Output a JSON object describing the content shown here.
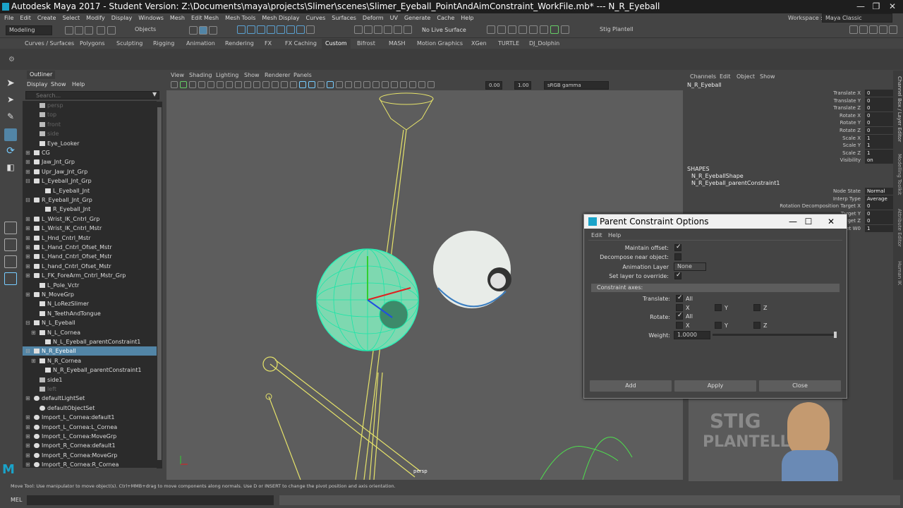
{
  "title": "Autodesk Maya 2017 - Student Version: Z:\\Documents\\maya\\projects\\Slimer\\scenes\\Slimer_Eyeball_PointAndAimConstraint_WorkFile.mb*   ---   N_R_Eyeball",
  "menu": [
    "File",
    "Edit",
    "Create",
    "Select",
    "Modify",
    "Display",
    "Windows",
    "Mesh",
    "Edit Mesh",
    "Mesh Tools",
    "Mesh Display",
    "Curves",
    "Surfaces",
    "Deform",
    "UV",
    "Generate",
    "Cache",
    "Help"
  ],
  "workspace_label": "Workspace :",
  "workspace_value": "Maya Classic",
  "status": {
    "mode": "Modeling",
    "select": "Objects",
    "live": "No Live Surface",
    "user": "Stig Plantell"
  },
  "shelf_tabs": [
    "Curves / Surfaces",
    "Polygons",
    "Sculpting",
    "Rigging",
    "Animation",
    "Rendering",
    "FX",
    "FX Caching",
    "Custom",
    "Bifrost",
    "MASH",
    "Motion Graphics",
    "XGen",
    "TURTLE",
    "DJ_Dolphin"
  ],
  "outliner": {
    "title": "Outliner",
    "menu": [
      "Display",
      "Show",
      "Help"
    ],
    "search_placeholder": "Search...",
    "items": [
      {
        "label": "persp",
        "indent": 1,
        "dim": true,
        "icon": "camera"
      },
      {
        "label": "top",
        "indent": 1,
        "dim": true,
        "icon": "camera"
      },
      {
        "label": "front",
        "indent": 1,
        "dim": true,
        "icon": "camera"
      },
      {
        "label": "side",
        "indent": 1,
        "dim": true,
        "icon": "camera"
      },
      {
        "label": "Eye_Looker",
        "indent": 1,
        "icon": "curve"
      },
      {
        "label": "CG",
        "indent": 0,
        "exp": "+",
        "icon": "curve"
      },
      {
        "label": "Jaw_Jnt_Grp",
        "indent": 0,
        "exp": "+",
        "icon": "group"
      },
      {
        "label": "Upr_Jaw_Jnt_Grp",
        "indent": 0,
        "exp": "+",
        "icon": "group"
      },
      {
        "label": "L_Eyeball_Jnt_Grp",
        "indent": 0,
        "exp": "-",
        "icon": "group"
      },
      {
        "label": "L_Eyeball_Jnt",
        "indent": 2,
        "icon": "joint"
      },
      {
        "label": "R_Eyeball_Jnt_Grp",
        "indent": 0,
        "exp": "-",
        "icon": "group"
      },
      {
        "label": "R_Eyeball_Jnt",
        "indent": 2,
        "icon": "joint"
      },
      {
        "label": "L_Wrist_IK_Cntrl_Grp",
        "indent": 0,
        "exp": "+",
        "icon": "group"
      },
      {
        "label": "L_Wrist_IK_Cntrl_Mstr",
        "indent": 0,
        "exp": "+",
        "icon": "group"
      },
      {
        "label": "L_Hnd_Cntrl_Mstr",
        "indent": 0,
        "exp": "+",
        "icon": "group"
      },
      {
        "label": "L_Hand_Cntrl_Ofset_Mstr",
        "indent": 0,
        "exp": "+",
        "icon": "group"
      },
      {
        "label": "L_Hand_Cntrl_Ofset_Mstr",
        "indent": 0,
        "exp": "+",
        "icon": "group"
      },
      {
        "label": "L_hand_Cntrl_Ofset_Mstr",
        "indent": 0,
        "exp": "+",
        "icon": "group"
      },
      {
        "label": "L_FK_ForeArm_Cntrl_Mstr_Grp",
        "indent": 0,
        "exp": "+",
        "icon": "group"
      },
      {
        "label": "L_Pole_Vctr",
        "indent": 1,
        "icon": "curve"
      },
      {
        "label": "N_MoveGrp",
        "indent": 0,
        "exp": "+",
        "icon": "group"
      },
      {
        "label": "N_LoRezSlimer",
        "indent": 1,
        "icon": "mesh"
      },
      {
        "label": "N_TeethAndTongue",
        "indent": 1,
        "icon": "mesh"
      },
      {
        "label": "N_L_Eyeball",
        "indent": 0,
        "exp": "-",
        "icon": "mesh"
      },
      {
        "label": "N_L_Cornea",
        "indent": 1,
        "exp": "+",
        "icon": "mesh"
      },
      {
        "label": "N_L_Eyeball_parentConstraint1",
        "indent": 2,
        "icon": "constraint"
      },
      {
        "label": "N_R_Eyeball",
        "indent": 0,
        "exp": "-",
        "icon": "mesh",
        "sel": true
      },
      {
        "label": "N_R_Cornea",
        "indent": 1,
        "exp": "+",
        "icon": "mesh"
      },
      {
        "label": "N_R_Eyeball_parentConstraint1",
        "indent": 2,
        "icon": "constraint"
      },
      {
        "label": "side1",
        "indent": 1,
        "icon": "camera"
      },
      {
        "label": "left",
        "indent": 1,
        "dim": true,
        "icon": "camera"
      },
      {
        "label": "defaultLightSet",
        "indent": 0,
        "exp": "+",
        "icon": "set"
      },
      {
        "label": "defaultObjectSet",
        "indent": 1,
        "icon": "set"
      },
      {
        "label": "Import_L_Cornea:default1",
        "indent": 0,
        "exp": "+",
        "icon": "set"
      },
      {
        "label": "Import_L_Cornea:L_Cornea",
        "indent": 0,
        "exp": "+",
        "icon": "set"
      },
      {
        "label": "Import_L_Cornea:MoveGrp",
        "indent": 0,
        "exp": "+",
        "icon": "set"
      },
      {
        "label": "Import_R_Cornea:default1",
        "indent": 0,
        "exp": "+",
        "icon": "set"
      },
      {
        "label": "Import_R_Cornea:MoveGrp",
        "indent": 0,
        "exp": "+",
        "icon": "set"
      },
      {
        "label": "Import_R_Cornea:R_Cornea",
        "indent": 0,
        "exp": "+",
        "icon": "set"
      }
    ]
  },
  "viewport": {
    "menu": [
      "View",
      "Shading",
      "Lighting",
      "Show",
      "Renderer",
      "Panels"
    ],
    "field1": "0.00",
    "field2": "1.00",
    "colorspace": "sRGB gamma",
    "camera": "persp"
  },
  "channelbox": {
    "menu": [
      "Channels",
      "Edit",
      "Object",
      "Show"
    ],
    "object": "N_R_Eyeball",
    "attrs": [
      {
        "name": "Translate X",
        "value": "0"
      },
      {
        "name": "Translate Y",
        "value": "0"
      },
      {
        "name": "Translate Z",
        "value": "0"
      },
      {
        "name": "Rotate X",
        "value": "0"
      },
      {
        "name": "Rotate Y",
        "value": "0"
      },
      {
        "name": "Rotate Z",
        "value": "0"
      },
      {
        "name": "Scale X",
        "value": "1"
      },
      {
        "name": "Scale Y",
        "value": "1"
      },
      {
        "name": "Scale Z",
        "value": "1"
      },
      {
        "name": "Visibility",
        "value": "on"
      }
    ],
    "shapes_label": "SHAPES",
    "shape1": "N_R_EyeballShape",
    "shape2": "N_R_Eyeball_parentConstraint1",
    "cattrs": [
      {
        "name": "Node State",
        "value": "Normal"
      },
      {
        "name": "Interp Type",
        "value": "Average"
      },
      {
        "name": "Rotation Decomposition Target X",
        "value": "0"
      },
      {
        "name": "Target Y",
        "value": "0"
      },
      {
        "name": "Target Z",
        "value": "0"
      },
      {
        "name": "Target W0",
        "value": "1"
      }
    ],
    "vtabs": [
      "Channel Box / Layer Editor",
      "Modelling Toolkit",
      "Attribute Editor",
      "Human IK"
    ]
  },
  "dialog": {
    "title": "Parent Constraint Options",
    "menu": [
      "Edit",
      "Help"
    ],
    "maintain_offset": "Maintain offset:",
    "decompose": "Decompose near object:",
    "anim_layer": "Animation Layer",
    "anim_layer_value": "None",
    "set_layer": "Set layer to override:",
    "axes_header": "Constraint axes:",
    "translate": "Translate:",
    "rotate": "Rotate:",
    "all": "All",
    "x": "X",
    "y": "Y",
    "z": "Z",
    "weight": "Weight:",
    "weight_value": "1.0000",
    "add": "Add",
    "apply": "Apply",
    "close": "Close"
  },
  "helpline": "Move Tool: Use manipulator to move object(s). Ctrl+MMB+drag to move components along normals. Use D or INSERT to change the pivot position and axis orientation.",
  "cmdline": "MEL",
  "logo_text": [
    "STIG",
    "PLANTELL"
  ]
}
